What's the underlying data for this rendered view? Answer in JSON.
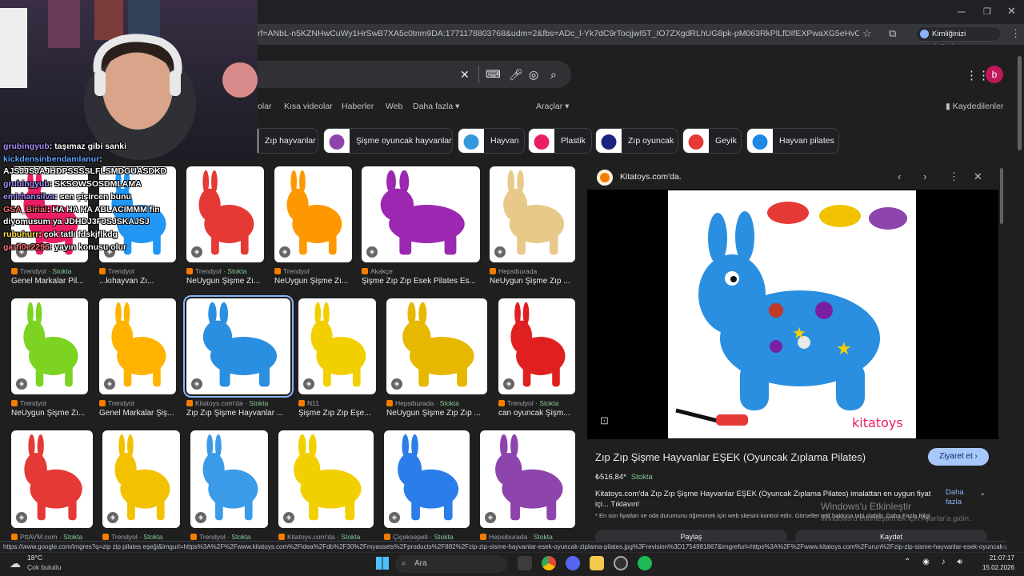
{
  "browser": {
    "url": "rf=ANbL-n5KZNHwCuWy1HrSwB7XA5c0tnm9DA:1771178803768&udm=2&fbs=ADc_l-Yk7dC9rTocjjwI5T_IO7ZXgdRLhUG8pk-pM063RkPlLfDIfEXPwaXG5eHvO7qyO_mxvB-_pt2ZyNJ...",
    "profile_label": "Kimliğinizi doğrulayın",
    "status_url": "https://www.google.com/imgres?q=zip zip pilates eşeği&imgurl=https%3A%2F%2Fwww.kitatoys.com%2Fidea%2Fdb%2F30%2Fmyassets%2Fproducts%2F882%2Fzip-zip-sisme-hayvanlar-esek-oyuncak-ziplama-pilates.jpg%3Frevision%3D1754981867&imgrefurl=https%3A%2F%2Fwww.kitatoys.com%2Furun%2Fzip-zip-sisme-hayvanlar-esek-oyuncak-zipl..."
  },
  "search": {
    "avatar_letter": "b",
    "tabs": [
      "olar",
      "Kısa videolar",
      "Haberler",
      "Web",
      "Daha fazla ▾"
    ],
    "tools": "Araçlar ▾",
    "saved": "Kaydedilenler"
  },
  "chips": [
    {
      "label": "Zıp hayvanlar",
      "color": "#f5c518"
    },
    {
      "label": "Şişme oyuncak hayvanlar",
      "color": "#8e44ad"
    },
    {
      "label": "Hayvan",
      "color": "#3498db"
    },
    {
      "label": "Plastik",
      "color": "#e91e63"
    },
    {
      "label": "Zıp oyuncak",
      "color": "#1a237e"
    },
    {
      "label": "Geyik",
      "color": "#e53935"
    },
    {
      "label": "Hayvan pilates",
      "color": "#1e88e5"
    }
  ],
  "results": [
    {
      "source": "Trendyol",
      "stock": "Stokta",
      "title": "Genel Markalar Pil...",
      "color": "#e91e63"
    },
    {
      "source": "Trendyol",
      "stock": "",
      "title": "...kıhayvan Zı...",
      "color": "#2196f3"
    },
    {
      "source": "Trendyol",
      "stock": "Stokta",
      "title": "NeUygun Şişme Zı...",
      "color": "#e53935"
    },
    {
      "source": "Trendyol",
      "stock": "",
      "title": "NeUygun Şişme Zı...",
      "color": "#ff9800"
    },
    {
      "source": "Akakçe",
      "stock": "",
      "title": "Şişme Zıp Zıp Esek Pilates Es...",
      "color": "#9c27b0"
    },
    {
      "source": "Hepsiburada",
      "stock": "",
      "title": "NeUygun Şişme Zıp ...",
      "color": "#e8c98a"
    },
    {
      "source": "Trendyol",
      "stock": "",
      "title": "NeUygun Şişme Zı...",
      "color": "#7cd321"
    },
    {
      "source": "Trendyol",
      "stock": "",
      "title": "Genel Markalar Şiş...",
      "color": "#ffb300"
    },
    {
      "source": "Kitatoys.com'da",
      "stock": "Stokta",
      "title": "Zıp Zıp Şişme Hayvanlar ...",
      "color": "#2a8fe0"
    },
    {
      "source": "N11",
      "stock": "",
      "title": "Şişme Zıp Zıp Eşe...",
      "color": "#f2d000"
    },
    {
      "source": "Hepsiburada",
      "stock": "Stokta",
      "title": "NeUygun Şişme Zıp Zıp ...",
      "color": "#e6b800"
    },
    {
      "source": "Trendyol",
      "stock": "Stokta",
      "title": "can oyuncak Şişm...",
      "color": "#e02020"
    },
    {
      "source": "PttAVM.com",
      "stock": "Stokta",
      "title": "",
      "color": "#e53935"
    },
    {
      "source": "Trendyol",
      "stock": "Stokta",
      "title": "",
      "color": "#f2c200"
    },
    {
      "source": "Trendyol",
      "stock": "Stokta",
      "title": "",
      "color": "#3b9be8"
    },
    {
      "source": "Kitatoys.com'da",
      "stock": "Stokta",
      "title": "",
      "color": "#f2d000"
    },
    {
      "source": "Çiçeksepeti",
      "stock": "Stokta",
      "title": "",
      "color": "#2b7de9"
    },
    {
      "source": "Hepsiburada",
      "stock": "Stokta",
      "title": "",
      "color": "#8e44ad"
    }
  ],
  "panel": {
    "site": "Kitatoys.com'da.",
    "title": "Zıp Zıp Şişme Hayvanlar EŞEK (Oyuncak Zıplama Pilates)",
    "visit": "Ziyaret et ›",
    "price": "₺516,84*",
    "stock": "Stokta",
    "description": "Kitatoys.com'da Zıp Zıp Şişme Hayvanlar EŞEK (Oyuncak Zıplama Pilates) imalattan en uygun fiyat içi... Tıklavın!",
    "more": "Daha fazla",
    "note": "* En son fiyatları ve oda durumunu öğrenmek için web sitesini kontrol edin. Görseller telif hakkına tabi olabilir. Daha Fazla Bilgi",
    "share": "Paylaş",
    "save": "Kaydet",
    "watermark_brand": "kitatoys"
  },
  "watermark": {
    "line1": "Windows'u Etkinleştir",
    "line2": "Windows'u etkinleştirmek için Ayarlar'a gidin."
  },
  "chat": [
    {
      "user": "grubingyub",
      "text": ": taşımaz gibi sanki",
      "cls": "u1"
    },
    {
      "user": "kickdensinbendamlanur",
      "text": ":",
      "cls": "u2"
    },
    {
      "user": "",
      "text": "AJSJJSJAJHDPSSSSLFLSMDĞÜASDKD",
      "cls": "u2"
    },
    {
      "user": "grubingyub",
      "text": ": SKSOWSOSDMLAMA",
      "cls": "u1"
    },
    {
      "user": "emirhansilva",
      "text": ": sen şişircen bunu",
      "cls": "u1"
    },
    {
      "user": "GSA_Birial",
      "text": ": HA HA HA ABLACIMMM fin diyomusum ya JDHDJ3FJSJSKAJSJ",
      "cls": "u3"
    },
    {
      "user": "rubuhurr",
      "text": ": çok tatlı fdskjflkdg",
      "cls": "u4"
    },
    {
      "user": "garfi0e2296",
      "text": ": yayın konusu olur",
      "cls": "u3"
    }
  ],
  "taskbar": {
    "temp": "18°C",
    "weather": "Çok bulutlu",
    "search": "Ara",
    "time": "21:07:17",
    "date": "15.02.2026"
  }
}
